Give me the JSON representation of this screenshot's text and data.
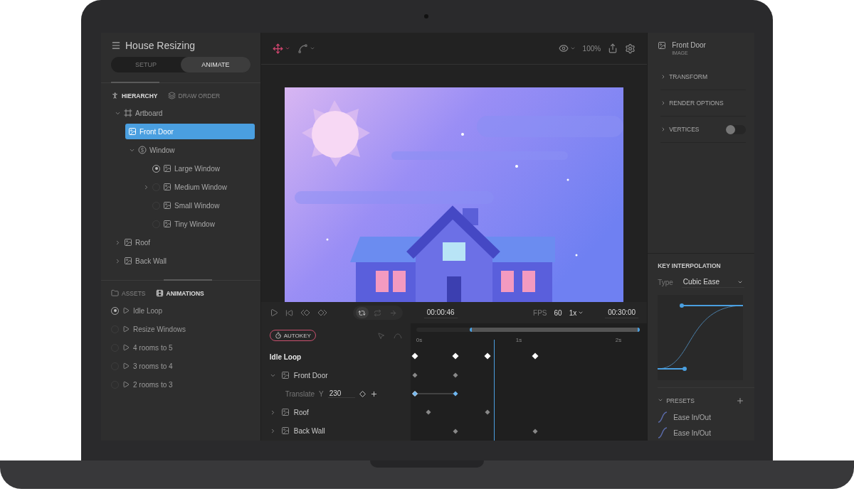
{
  "project": {
    "title": "House Resizing"
  },
  "mode_tabs": [
    {
      "label": "SETUP",
      "selected": false
    },
    {
      "label": "ANIMATE",
      "selected": true
    }
  ],
  "panel_tabs": [
    {
      "label": "HIERARCHY",
      "selected": true
    },
    {
      "label": "DRAW ORDER",
      "selected": false
    }
  ],
  "hierarchy": [
    {
      "label": "Artboard",
      "kind": "artboard",
      "expanded": true,
      "selected": false,
      "children": [
        {
          "label": "Front Door",
          "kind": "image",
          "selected": true
        },
        {
          "label": "Window",
          "kind": "solo",
          "expanded": true,
          "selected": false,
          "children": [
            {
              "label": "Large Window",
              "kind": "image",
              "selected": false,
              "active": true
            },
            {
              "label": "Medium Window",
              "kind": "image",
              "selected": false,
              "active": false,
              "expanded": false
            },
            {
              "label": "Small Window",
              "kind": "image",
              "selected": false,
              "active": false
            },
            {
              "label": "Tiny Window",
              "kind": "image",
              "selected": false,
              "active": false
            }
          ]
        }
      ]
    },
    {
      "label": "Roof",
      "kind": "image",
      "expanded": false,
      "selected": false
    },
    {
      "label": "Back Wall",
      "kind": "image",
      "expanded": false,
      "selected": false
    }
  ],
  "library_tabs": [
    {
      "label": "ASSETS",
      "selected": false
    },
    {
      "label": "ANIMATIONS",
      "selected": true
    }
  ],
  "animations": [
    {
      "name": "Idle Loop",
      "selected": true
    },
    {
      "name": "Resize Windows",
      "selected": false
    },
    {
      "name": "4 rooms to 5",
      "selected": false
    },
    {
      "name": "3 rooms to 4",
      "selected": false
    },
    {
      "name": "2 rooms to 3",
      "selected": false
    }
  ],
  "toolbar": {
    "tools": [
      {
        "kind": "move",
        "active": true
      },
      {
        "kind": "bones",
        "active": false
      }
    ],
    "zoom": "100%"
  },
  "playback": {
    "loop_modes": [
      {
        "kind": "pingpong",
        "selected": true
      },
      {
        "kind": "loop",
        "selected": false
      },
      {
        "kind": "oneshot",
        "selected": false
      }
    ],
    "current_time": "00:00:46",
    "fps_label": "FPS",
    "fps": "60",
    "speed": "1x",
    "duration": "00:30:00"
  },
  "timeline": {
    "autokey": {
      "label": "AUTOKEY",
      "on": true
    },
    "ruler": [
      "0s",
      "1s",
      "2s"
    ],
    "rows": [
      {
        "kind": "animation",
        "label": "Idle Loop"
      },
      {
        "kind": "object",
        "label": "Front Door",
        "expanded": true
      },
      {
        "kind": "property",
        "label": "Translate",
        "axis": "Y",
        "value": "230"
      },
      {
        "kind": "object",
        "label": "Roof",
        "expanded": false
      },
      {
        "kind": "object",
        "label": "Back Wall",
        "expanded": false
      }
    ]
  },
  "inspector": {
    "name": "Front Door",
    "type": "IMAGE",
    "sections": [
      {
        "kind": "section",
        "label": "TRANSFORM"
      },
      {
        "kind": "section",
        "label": "RENDER OPTIONS"
      },
      {
        "kind": "toggle",
        "label": "VERTICES",
        "on": false
      }
    ],
    "interpolation": {
      "title": "KEY INTERPOLATION",
      "type_label": "Type",
      "type_value": "Cubic Ease"
    },
    "presets": {
      "title": "PRESETS",
      "expanded": true,
      "items": [
        "Ease In/Out",
        "Ease In/Out"
      ]
    }
  }
}
